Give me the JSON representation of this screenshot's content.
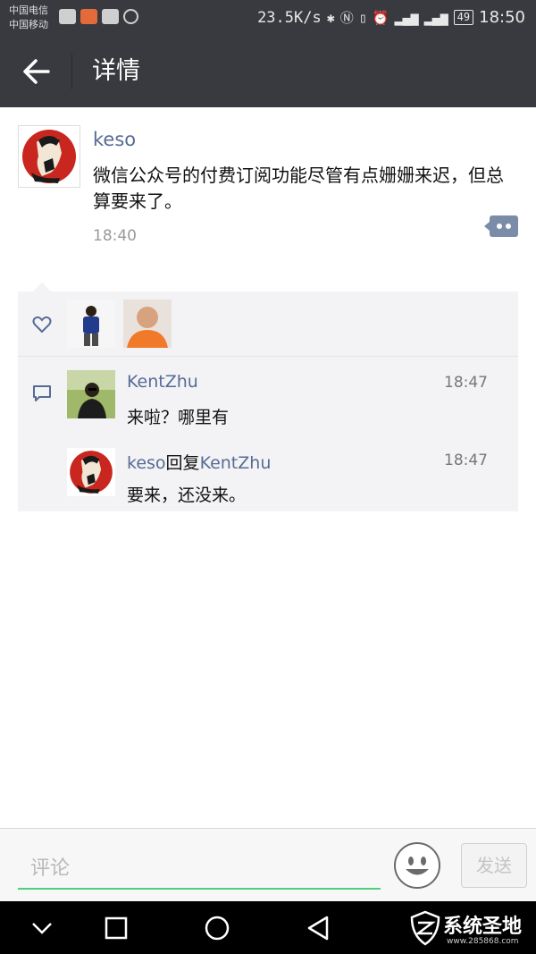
{
  "status_bar": {
    "carrier_1": "中国电信",
    "carrier_2": "中国移动",
    "net_speed": "23.5K/s",
    "battery": "49",
    "time": "18:50"
  },
  "nav": {
    "title": "详情"
  },
  "post": {
    "author": "keso",
    "content": "微信公众号的付费订阅功能尽管有点姗姗来迟，但总算要来了。",
    "time": "18:40"
  },
  "comments": [
    {
      "author": "KentZhu",
      "reply_word": "",
      "reply_to": "",
      "time": "18:47",
      "text": "来啦？哪里有"
    },
    {
      "author": "keso",
      "reply_word": "回复",
      "reply_to": "KentZhu",
      "time": "18:47",
      "text": "要来，还没来。"
    }
  ],
  "input": {
    "placeholder": "评论",
    "send_label": "发送"
  },
  "watermark": {
    "brand": "系统圣地",
    "url": "www.285868.com"
  },
  "colors": {
    "bar": "#393a3f",
    "link": "#576b95",
    "input_underline": "#4cd07d",
    "panel": "#f3f3f5"
  }
}
